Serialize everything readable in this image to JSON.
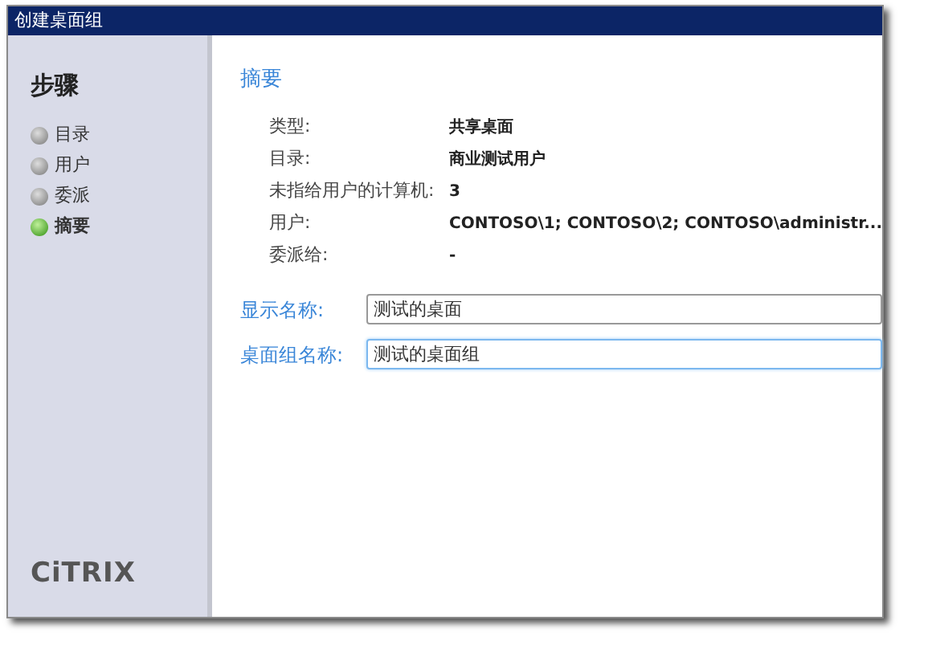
{
  "window": {
    "title": "创建桌面组"
  },
  "sidebar": {
    "heading": "步骤",
    "steps": [
      {
        "label": "目录",
        "selected": false
      },
      {
        "label": "用户",
        "selected": false
      },
      {
        "label": "委派",
        "selected": false
      },
      {
        "label": "摘要",
        "selected": true
      }
    ],
    "logo": "CiTRIX"
  },
  "summary": {
    "heading": "摘要",
    "rows": [
      {
        "label": "类型:",
        "value": "共享桌面"
      },
      {
        "label": "目录:",
        "value": "商业测试用户"
      },
      {
        "label": "未指给用户的计算机:",
        "value": "3"
      },
      {
        "label": "用户:",
        "value": "CONTOSO\\1; CONTOSO\\2; CONTOSO\\administr..."
      },
      {
        "label": "委派给:",
        "value": "-"
      }
    ]
  },
  "fields": [
    {
      "label": "显示名称:",
      "value": "测试的桌面",
      "focused": false
    },
    {
      "label": "桌面组名称:",
      "value": "测试的桌面组",
      "focused": true
    }
  ]
}
